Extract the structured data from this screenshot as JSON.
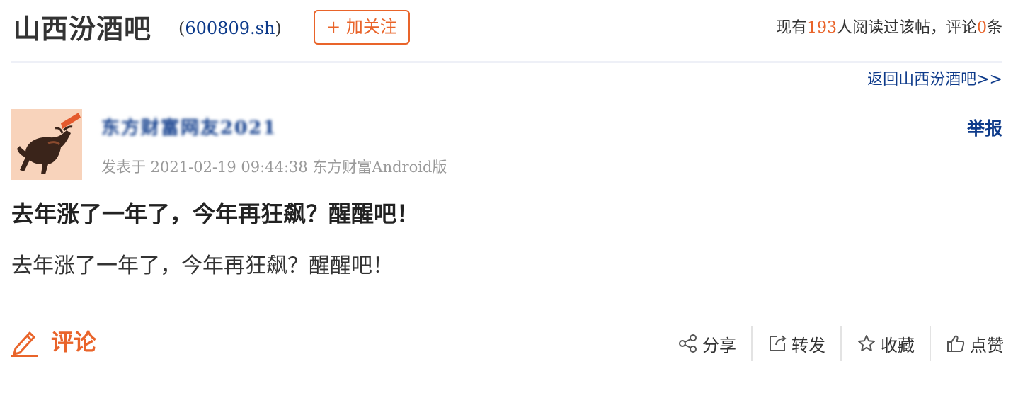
{
  "header": {
    "bar_title": "山西汾酒吧",
    "stock_open": "(",
    "stock_code": "600809.sh",
    "stock_close": ")",
    "follow_label": "+ 加关注",
    "stats": {
      "prefix": "现有",
      "read_count": "193",
      "middle": "人阅读过该帖，评论",
      "comment_count": "0",
      "suffix": "条"
    },
    "back_link": "返回山西汾酒吧>>"
  },
  "post": {
    "author_name": "东方财富网友2021",
    "meta": "发表于 2021-02-19 09:44:38 东方财富Android版",
    "report_label": "举报",
    "title": "去年涨了一年了，今年再狂飙？醒醒吧！",
    "body": "去年涨了一年了，今年再狂飙？醒醒吧！"
  },
  "footer": {
    "comment_label": "评论",
    "actions": {
      "share": "分享",
      "forward": "转发",
      "favorite": "收藏",
      "like": "点赞"
    }
  },
  "colors": {
    "accent": "#e9642a",
    "link": "#0d3a8a",
    "meta": "#999999",
    "text": "#333333"
  },
  "icons": {
    "avatar": "bull-avatar-icon",
    "comment": "pencil-icon",
    "share": "share-icon",
    "forward": "forward-icon",
    "favorite": "star-icon",
    "like": "thumbs-up-icon"
  }
}
